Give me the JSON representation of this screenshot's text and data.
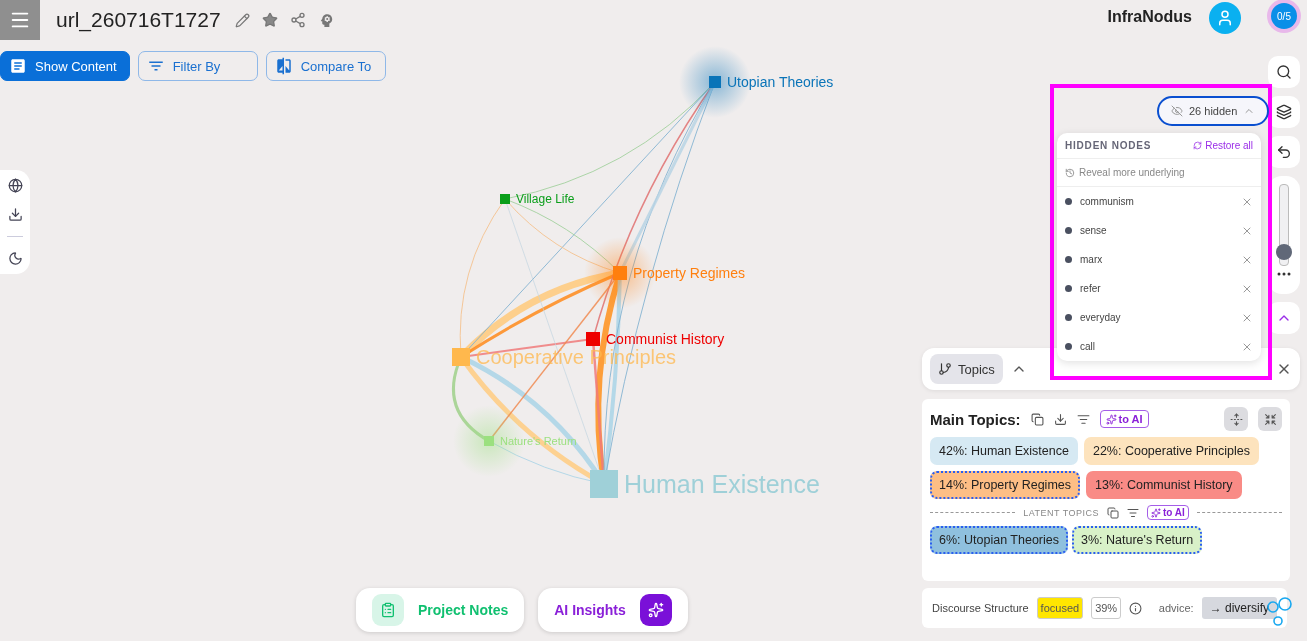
{
  "header": {
    "title": "url_260716T1727",
    "brand": "InfraNodus",
    "counter": "0/5"
  },
  "toolbar": [
    {
      "label": "Show Content",
      "selected": true
    },
    {
      "label": "Filter By",
      "selected": false
    },
    {
      "label": "Compare To",
      "selected": false
    }
  ],
  "graph": {
    "nodes": [
      {
        "label": "Utopian Theories",
        "color": "#0a74b8",
        "glow": true
      },
      {
        "label": "Village Life",
        "color": "#0a9e1a",
        "glow": false
      },
      {
        "label": "Property Regimes",
        "color": "#ff7f0e",
        "glow": true
      },
      {
        "label": "Communist History",
        "color": "#ee0000",
        "glow": false
      },
      {
        "label": "Cooperative Principles",
        "color": "#ffb84d",
        "glow": false
      },
      {
        "label": "Nature's Return",
        "color": "#9be07f",
        "glow": true
      },
      {
        "label": "Human Existence",
        "color": "#9fd0d8",
        "glow": false
      }
    ]
  },
  "hidden_panel": {
    "toggle": "26 hidden",
    "expanded": true,
    "title": "HIDDEN NODES",
    "restore": "Restore all",
    "reveal": "Reveal more underlying",
    "items": [
      "communism",
      "sense",
      "marx",
      "refer",
      "everyday",
      "call"
    ]
  },
  "zoom": {
    "level": 0.08
  },
  "tabs": [
    {
      "label": "Topics",
      "selected": true
    }
  ],
  "topics": {
    "title": "Main Topics:",
    "to_ai": "to AI",
    "latent_title": "LATENT TOPICS",
    "latent_to_ai": "to AI",
    "main": [
      {
        "label": "42%: Human Existence",
        "color": "#d6e9f3",
        "highlighted": false
      },
      {
        "label": "22%: Cooperative Principles",
        "color": "#fde3bd",
        "highlighted": false
      },
      {
        "label": "14%: Property Regimes",
        "color": "#fdbe85",
        "highlighted": true
      },
      {
        "label": "13%: Communist History",
        "color": "#f98b86",
        "highlighted": false
      }
    ],
    "latent": [
      {
        "label": "6%: Utopian Theories",
        "color": "#8fc0de",
        "highlighted": true
      },
      {
        "label": "3%: Nature's Return",
        "color": "#d8f1c8",
        "highlighted": true
      }
    ]
  },
  "structure": {
    "label": "Discourse Structure",
    "state": "focused",
    "percent": "39%",
    "advice_label": "advice:",
    "advice": "→ diversify"
  },
  "bottom": {
    "notes": "Project Notes",
    "insights": "AI Insights"
  }
}
